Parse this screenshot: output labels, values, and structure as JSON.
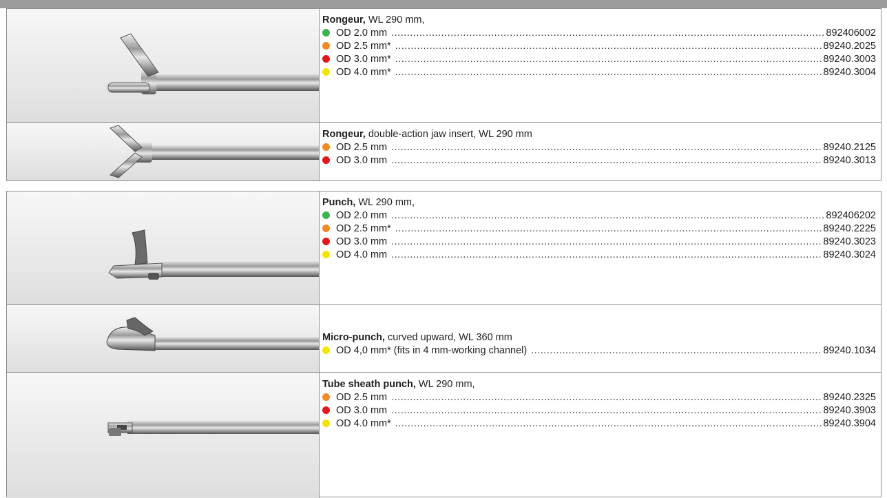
{
  "colors": {
    "green": "#3cb54a",
    "orange": "#f08a24",
    "red": "#e3171b",
    "yellow": "#f5e400",
    "border": "#8e8e8e",
    "topbar": "#9b9b9b"
  },
  "groups": [
    {
      "rows": [
        {
          "image": "rongeur-instrument-image",
          "title_bold": "Rongeur,",
          "title_rest": " WL 290 mm,",
          "items": [
            {
              "color": "green",
              "label": "OD 2.0 mm",
              "code": "892406002"
            },
            {
              "color": "orange",
              "label": "OD 2.5 mm*",
              "code": "89240.2025"
            },
            {
              "color": "red",
              "label": "OD 3.0 mm*",
              "code": "89240.3003"
            },
            {
              "color": "yellow",
              "label": "OD 4.0 mm*",
              "code": "89240.3004"
            }
          ]
        },
        {
          "image": "double-action-rongeur-image",
          "title_bold": "Rongeur,",
          "title_rest": " double-action jaw insert, WL 290 mm",
          "items": [
            {
              "color": "orange",
              "label": "OD 2.5 mm",
              "code": "89240.2125"
            },
            {
              "color": "red",
              "label": "OD 3.0 mm",
              "code": "89240.3013"
            }
          ]
        }
      ]
    },
    {
      "rows": [
        {
          "image": "punch-instrument-image",
          "title_bold": "Punch,",
          "title_rest": " WL 290 mm,",
          "items": [
            {
              "color": "green",
              "label": "OD 2.0 mm",
              "code": "892406202"
            },
            {
              "color": "orange",
              "label": "OD 2.5 mm*",
              "code": "89240.2225"
            },
            {
              "color": "red",
              "label": "OD 3.0 mm",
              "code": "89240.3023"
            },
            {
              "color": "yellow",
              "label": "OD 4.0 mm",
              "code": "89240.3024"
            }
          ]
        },
        {
          "image": "micro-punch-instrument-image",
          "title_bold": "Micro-punch,",
          "title_rest": " curved upward, WL 360 mm",
          "items": [
            {
              "color": "yellow",
              "label": "OD 4,0 mm* (fits in 4 mm-working channel)",
              "code": "89240.1034"
            }
          ]
        },
        {
          "image": "tube-sheath-punch-image",
          "title_bold": "Tube sheath punch,",
          "title_rest": " WL 290 mm,",
          "items": [
            {
              "color": "orange",
              "label": "OD 2.5 mm",
              "code": "89240.2325"
            },
            {
              "color": "red",
              "label": "OD 3.0 mm",
              "code": "89240.3903"
            },
            {
              "color": "yellow",
              "label": "OD 4.0 mm*",
              "code": "89240.3904"
            }
          ]
        }
      ]
    }
  ]
}
